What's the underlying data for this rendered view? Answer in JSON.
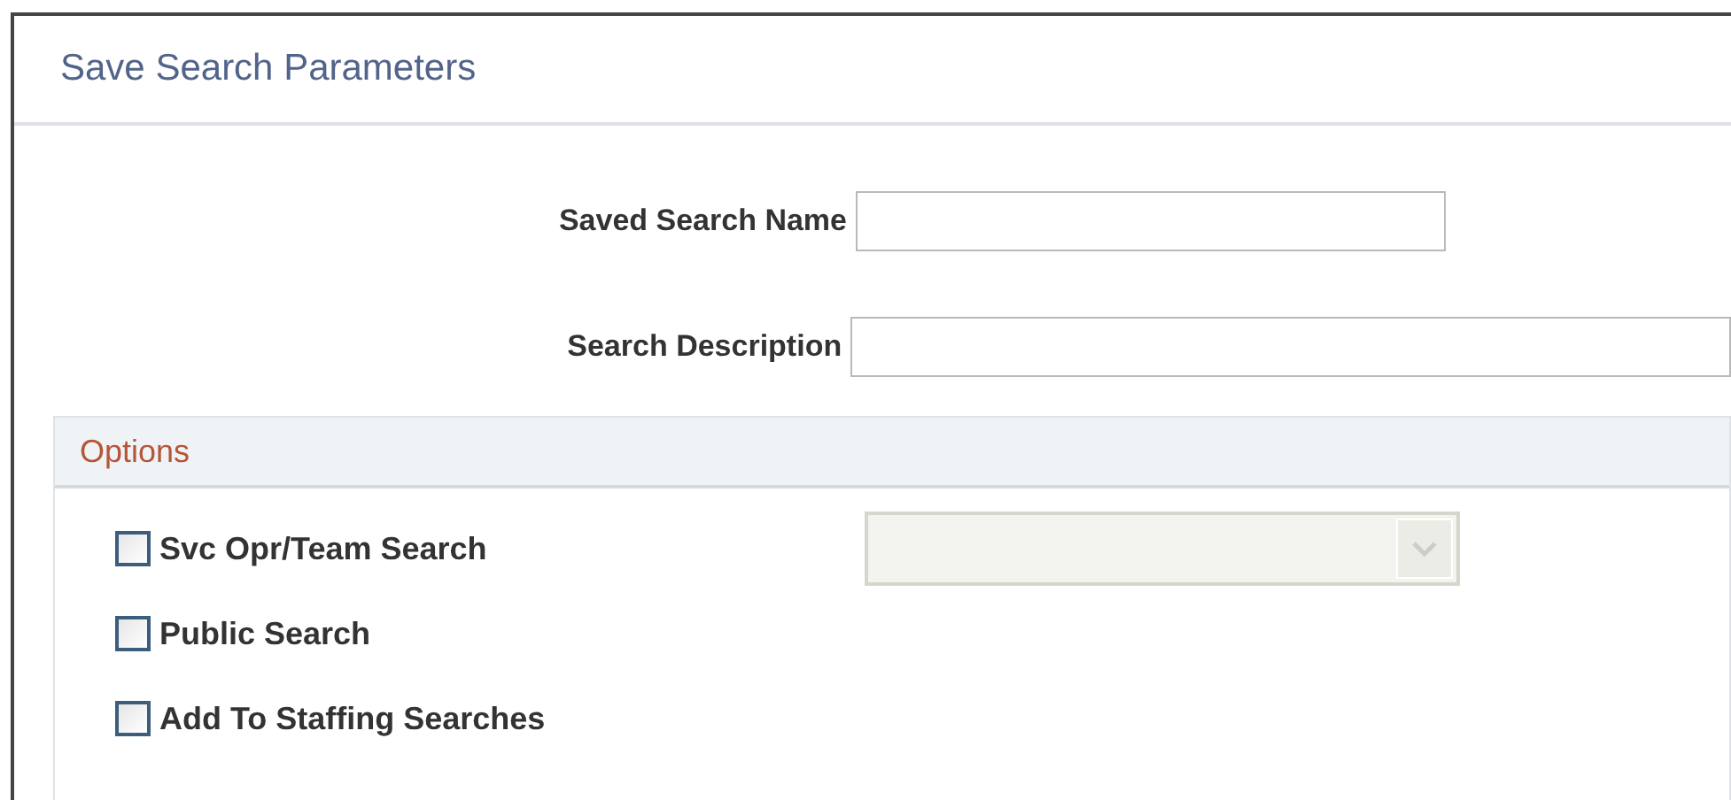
{
  "window": {
    "title": "Save Search Parameters"
  },
  "fields": [
    {
      "label": "Saved Search Name",
      "kind": "short"
    },
    {
      "label": "Search Description",
      "kind": "long"
    }
  ],
  "options": {
    "title": "Options",
    "items": [
      {
        "label": "Svc Opr/Team Search",
        "checked": false,
        "dropdown": {
          "disabled": true
        }
      },
      {
        "label": "Public Search",
        "checked": false
      },
      {
        "label": "Add To Staffing Searches",
        "checked": false
      }
    ]
  }
}
